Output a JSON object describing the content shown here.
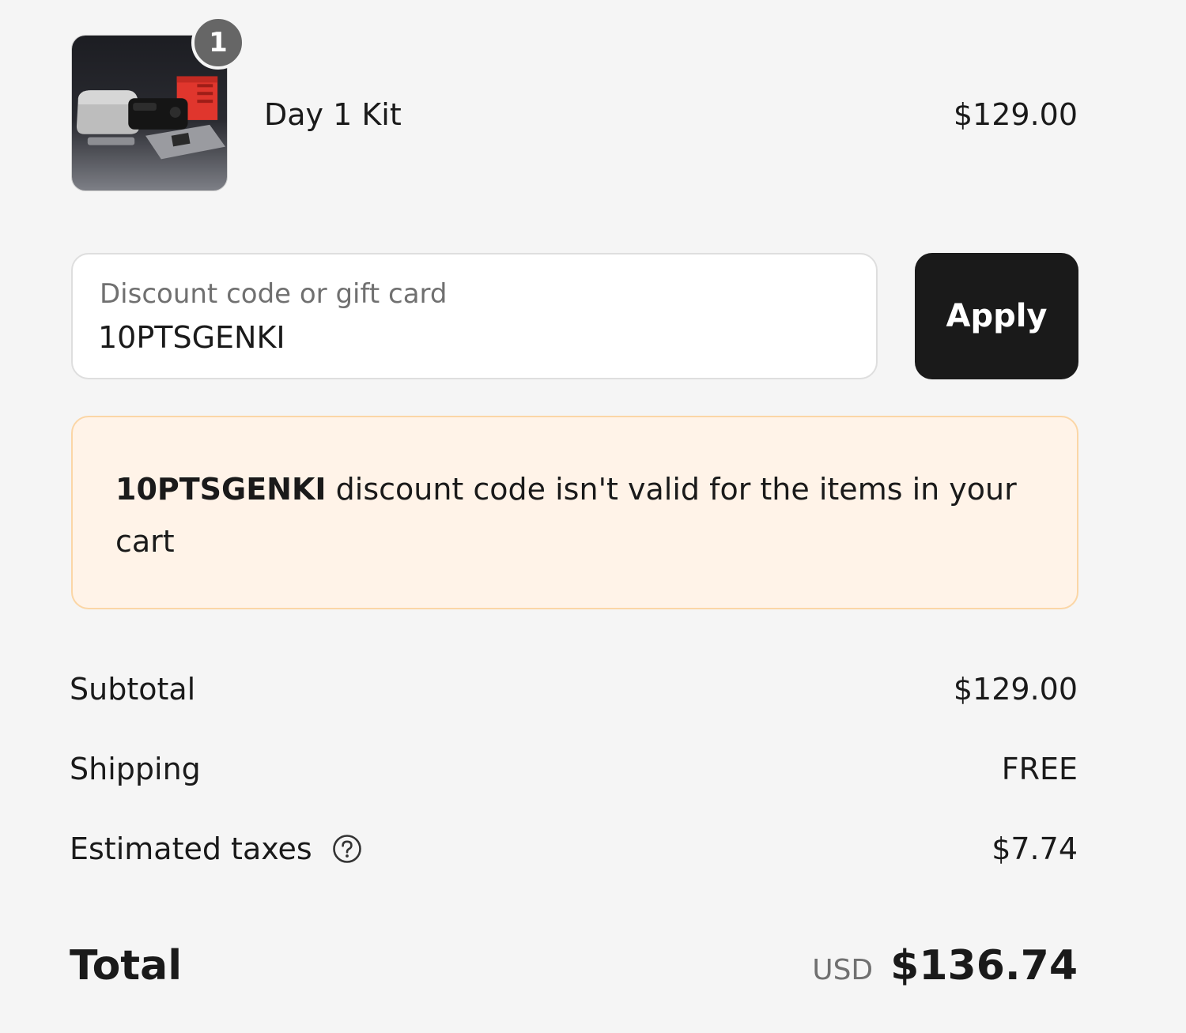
{
  "line_item": {
    "quantity": "1",
    "name": "Day 1 Kit",
    "price": "$129.00",
    "image_icon": "product-kit-thumbnail"
  },
  "discount": {
    "label": "Discount code or gift card",
    "value": "10PTSGENKI",
    "apply_label": "Apply"
  },
  "error": {
    "code": "10PTSGENKI",
    "message": " discount code isn't valid for the items in your cart"
  },
  "summary": {
    "subtotal_label": "Subtotal",
    "subtotal_value": "$129.00",
    "shipping_label": "Shipping",
    "shipping_value": "FREE",
    "taxes_label": "Estimated taxes",
    "taxes_icon": "question-circle-icon",
    "taxes_value": "$7.74"
  },
  "total": {
    "label": "Total",
    "currency": "USD",
    "amount": "$136.74"
  },
  "colors": {
    "background": "#f5f5f5",
    "apply_button": "#1a1a1a",
    "error_background": "#fff3e8",
    "error_border": "#fbd6a6",
    "badge": "#666666"
  }
}
